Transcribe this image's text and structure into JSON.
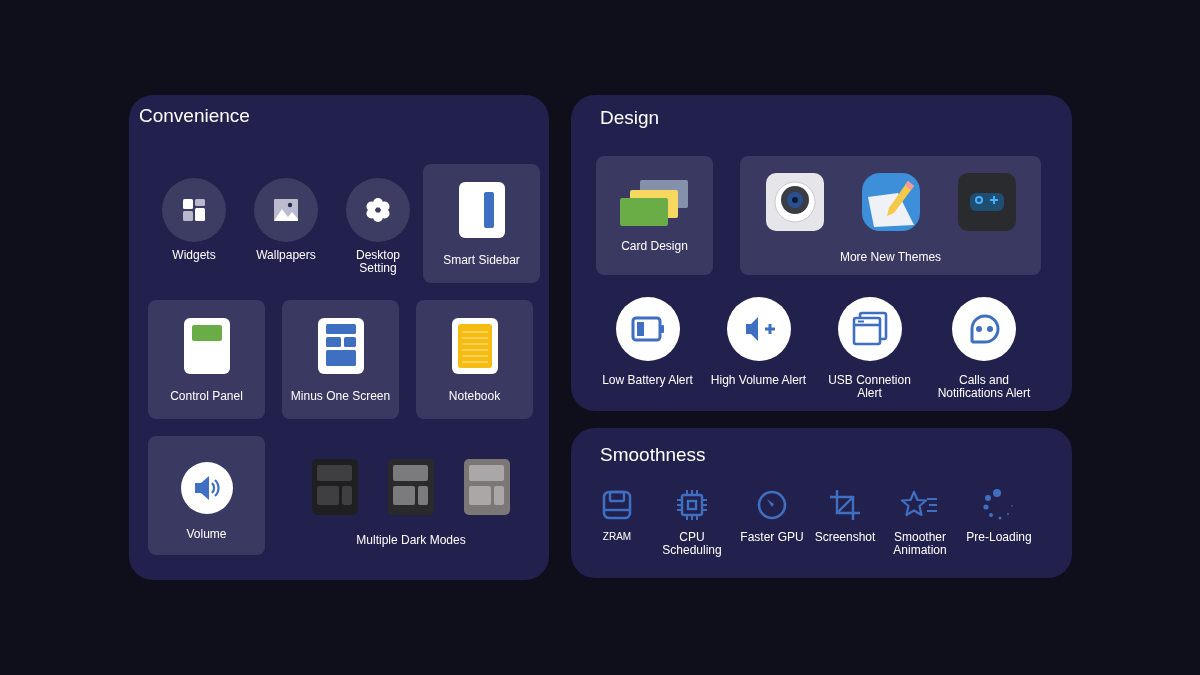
{
  "convenience": {
    "title": "Convenience",
    "items": [
      {
        "label": "Widgets",
        "kind": "circle"
      },
      {
        "label": "Wallpapers",
        "kind": "circle"
      },
      {
        "label": "Desktop Setting",
        "kind": "circle"
      },
      {
        "label": "Smart Sidebar",
        "kind": "tile"
      },
      {
        "label": "Control Panel",
        "kind": "tile"
      },
      {
        "label": "Minus One Screen",
        "kind": "tile"
      },
      {
        "label": "Notebook",
        "kind": "tile"
      },
      {
        "label": "Volume",
        "kind": "tile"
      },
      {
        "label": "Multiple Dark Modes",
        "kind": "group"
      }
    ]
  },
  "design": {
    "title": "Design",
    "tiles": [
      {
        "label": "Card Design"
      },
      {
        "label": "More New Themes"
      }
    ],
    "alerts": [
      {
        "label": "Low Battery Alert",
        "kind": "badge"
      },
      {
        "label": "High Volume Alert",
        "kind": "badge"
      },
      {
        "label": "USB Connetion Alert",
        "kind": "badge"
      },
      {
        "label": "Calls and Notifications Alert",
        "kind": "badge"
      }
    ]
  },
  "smoothness": {
    "title": "Smoothness",
    "items": [
      {
        "label": "ZRAM"
      },
      {
        "label": "CPU Scheduling"
      },
      {
        "label": "Faster GPU"
      },
      {
        "label": "Screenshot"
      },
      {
        "label": "Smoother Animation"
      },
      {
        "label": "Pre-Loading"
      }
    ]
  }
}
